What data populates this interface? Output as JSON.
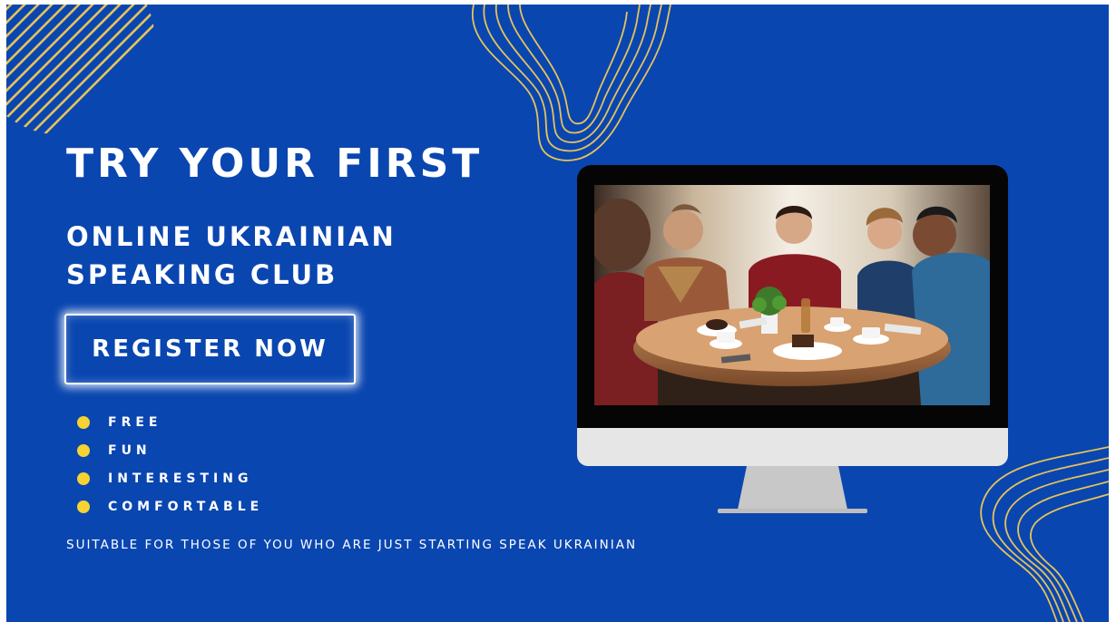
{
  "banner": {
    "headline": "TRY YOUR FIRST",
    "subhead_line1": "ONLINE UKRAINIAN",
    "subhead_line2": "SPEAKING CLUB",
    "register_label": "REGISTER NOW",
    "features": [
      {
        "label": "FREE"
      },
      {
        "label": "FUN"
      },
      {
        "label": "INTERESTING"
      },
      {
        "label": "COMFORTABLE"
      }
    ],
    "suitable_text": "SUITABLE FOR THOSE OF YOU WHO ARE JUST STARTING SPEAK UKRAINIAN"
  },
  "colors": {
    "background": "#0a46b0",
    "accent_yellow": "#f6d233",
    "line_gold": "#e6c25a",
    "text": "#ffffff"
  }
}
